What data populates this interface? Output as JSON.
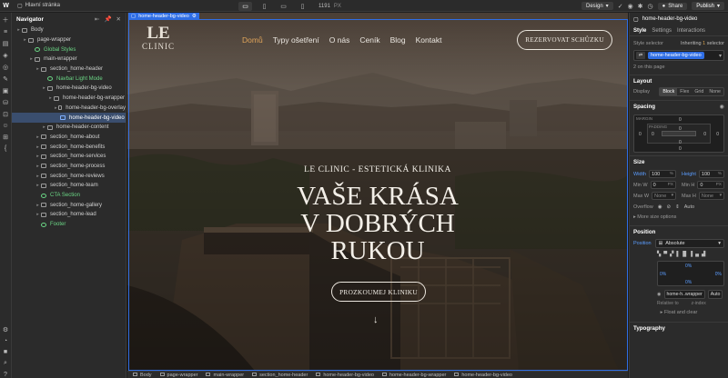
{
  "topbar": {
    "logo": "W",
    "page_name": "Hlavní stránka",
    "width_value": "1191",
    "width_unit": "PX",
    "mode": "Design",
    "share": "Share",
    "publish": "Publish"
  },
  "navigator": {
    "title": "Navigator",
    "items": [
      {
        "label": "Body",
        "indent": 0,
        "type": "box"
      },
      {
        "label": "page-wrapper",
        "indent": 1,
        "type": "box"
      },
      {
        "label": "Global Styles",
        "indent": 2,
        "type": "comp"
      },
      {
        "label": "main-wrapper",
        "indent": 2,
        "type": "box"
      },
      {
        "label": "section_home-header",
        "indent": 3,
        "type": "box"
      },
      {
        "label": "Navbar Light Mode",
        "indent": 4,
        "type": "comp"
      },
      {
        "label": "home-header-bg-video",
        "indent": 4,
        "type": "box"
      },
      {
        "label": "home-header-bg-wrapper",
        "indent": 5,
        "type": "box"
      },
      {
        "label": "home-header-bg-overlay",
        "indent": 6,
        "type": "box"
      },
      {
        "label": "home-header-bg-video",
        "indent": 6,
        "type": "box",
        "selected": true
      },
      {
        "label": "home-header-content",
        "indent": 4,
        "type": "box"
      },
      {
        "label": "section_home-about",
        "indent": 3,
        "type": "box"
      },
      {
        "label": "section_home-benefits",
        "indent": 3,
        "type": "box"
      },
      {
        "label": "section_home-services",
        "indent": 3,
        "type": "box"
      },
      {
        "label": "section_home-process",
        "indent": 3,
        "type": "box"
      },
      {
        "label": "section_home-reviews",
        "indent": 3,
        "type": "box"
      },
      {
        "label": "section_home-team",
        "indent": 3,
        "type": "box"
      },
      {
        "label": "CTA Section",
        "indent": 3,
        "type": "comp"
      },
      {
        "label": "section_home-gallery",
        "indent": 3,
        "type": "box"
      },
      {
        "label": "section_home-lead",
        "indent": 3,
        "type": "box"
      },
      {
        "label": "Footer",
        "indent": 3,
        "type": "comp"
      }
    ]
  },
  "canvas": {
    "selected_label": "home-header-bg-video",
    "site": {
      "logo_mark": "LE",
      "logo_word": "CLINIC",
      "menu": [
        {
          "label": "Domů",
          "active": true
        },
        {
          "label": "Typy ošetření",
          "active": false
        },
        {
          "label": "O nás",
          "active": false
        },
        {
          "label": "Ceník",
          "active": false
        },
        {
          "label": "Blog",
          "active": false
        },
        {
          "label": "Kontakt",
          "active": false
        }
      ],
      "cta": "REZERVOVAT SCHŮZKU",
      "eyebrow": "LE CLINIC - ESTETICKÁ KLINIKA",
      "headline_lines": [
        "VAŠE KRÁSA",
        "V DOBRÝCH",
        "RUKOU"
      ],
      "explore": "PROZKOUMEJ KLINIKU",
      "arrow": "↓"
    }
  },
  "breadcrumbs": [
    "Body",
    "page-wrapper",
    "main-wrapper",
    "section_home-header",
    "home-header-bg-video",
    "home-header-bg-wrapper",
    "home-header-bg-video"
  ],
  "right_panel": {
    "element_name": "home-header-bg-video",
    "tabs": [
      "Style",
      "Settings",
      "Interactions"
    ],
    "style_selector_label": "Style selector",
    "inheriting_prefix": "Inheriting",
    "inheriting_count": "1",
    "inheriting_suffix": "selector",
    "selector_class": "home-header-bg-video",
    "on_page": "2 on this page",
    "layout": {
      "title": "Layout",
      "display_label": "Display",
      "display_options": [
        "Block",
        "Flex",
        "Grid",
        "None"
      ],
      "display_selected": "Block"
    },
    "spacing": {
      "title": "Spacing",
      "margin_label": "MARGIN",
      "padding_label": "PADDING",
      "values": "0"
    },
    "size": {
      "title": "Size",
      "width_label": "Width",
      "width_value": "100",
      "width_unit": "%",
      "height_label": "Height",
      "height_value": "100",
      "height_unit": "%",
      "minw_label": "Min W",
      "minw_value": "0",
      "minw_unit": "PX",
      "minh_label": "Min H",
      "minh_value": "0",
      "minh_unit": "PX",
      "maxw_label": "Max W",
      "maxw_value": "None",
      "maxh_label": "Max H",
      "maxh_value": "None",
      "overflow_label": "Overflow",
      "more": "More size options"
    },
    "position": {
      "title": "Position",
      "label": "Position",
      "value": "Absolute",
      "pct": "0%",
      "relative_el": "home-h..wrapper",
      "relative_auto": "Auto",
      "relative_to": "Relative to",
      "z_index": "z-index",
      "float": "Float and clear"
    },
    "typography_title": "Typography"
  }
}
